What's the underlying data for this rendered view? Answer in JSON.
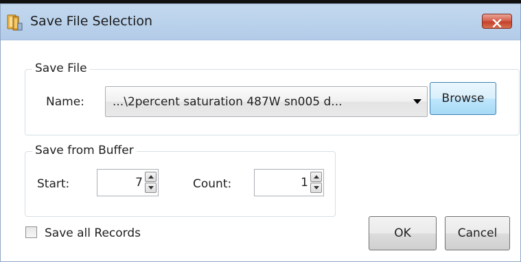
{
  "window": {
    "title": "Save File Selection",
    "close_glyph": "✕"
  },
  "save_file": {
    "group_label": "Save File",
    "name_label": "Name:",
    "name_value": "...\\2percent saturation 487W sn005 d...",
    "browse_label": "Browse"
  },
  "buffer": {
    "group_label": "Save from Buffer",
    "start_label": "Start:",
    "start_value": "7",
    "count_label": "Count:",
    "count_value": "1"
  },
  "options": {
    "save_all_label": "Save all Records",
    "save_all_checked": false
  },
  "actions": {
    "ok_label": "OK",
    "cancel_label": "Cancel"
  },
  "colors": {
    "titlebar": "#bcd3ec",
    "close_button": "#c4412c",
    "focus_border": "#3c7fb1"
  }
}
